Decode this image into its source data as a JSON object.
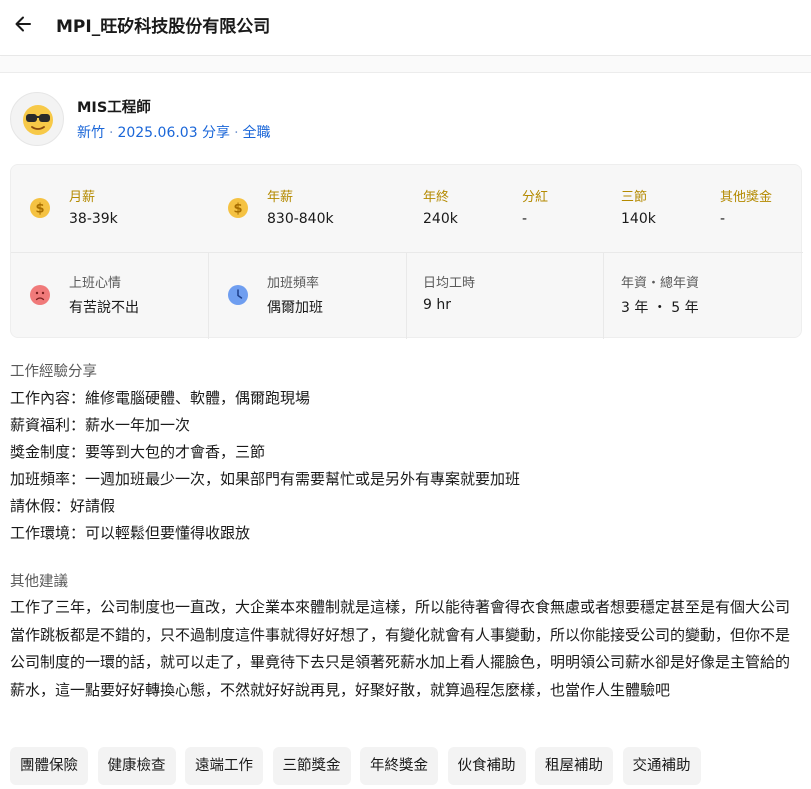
{
  "header": {
    "title": "MPI_旺矽科技股份有限公司"
  },
  "profile": {
    "job_title": "MIS工程師",
    "location": "新竹",
    "date_shared": "2025.06.03 分享",
    "employment_type": "全職",
    "avatar_icon": "sunglasses-face-icon"
  },
  "salary": {
    "monthly": {
      "label": "月薪",
      "value": "38-39k",
      "icon": "coin-icon"
    },
    "yearly": {
      "label": "年薪",
      "value": "830-840k",
      "icon": "coin-icon"
    },
    "year_end_bonus": {
      "label": "年終",
      "value": "240k"
    },
    "profit_sharing": {
      "label": "分紅",
      "value": "-"
    },
    "three_festivals": {
      "label": "三節",
      "value": "140k"
    },
    "other_bonus": {
      "label": "其他獎金",
      "value": "-"
    }
  },
  "work_stats": {
    "mood": {
      "label": "上班心情",
      "value": "有苦說不出",
      "icon": "sad-face-icon"
    },
    "overtime": {
      "label": "加班頻率",
      "value": "偶爾加班",
      "icon": "clock-icon"
    },
    "daily_hours": {
      "label": "日均工時",
      "value": "9 hr"
    },
    "seniority": {
      "label": "年資・總年資",
      "value": "3 年 ・ 5 年"
    }
  },
  "experience": {
    "heading": "工作經驗分享",
    "lines": [
      "工作內容：維修電腦硬體、軟體，偶爾跑現場",
      "薪資福利：薪水一年加一次",
      "獎金制度：要等到大包的才會香，三節",
      "加班頻率：一週加班最少一次，如果部門有需要幫忙或是另外有專案就要加班",
      "請休假：好請假",
      "工作環境：可以輕鬆但要懂得收跟放"
    ]
  },
  "advice": {
    "heading": "其他建議",
    "text": "工作了三年，公司制度也一直改，大企業本來體制就是這樣，所以能待著會得衣食無慮或者想要穩定甚至是有個大公司當作跳板都是不錯的，只不過制度這件事就得好好想了，有變化就會有人事變動，所以你能接受公司的變動，但你不是公司制度的一環的話，就可以走了，畢竟待下去只是領著死薪水加上看人擺臉色，明明領公司薪水卻是好像是主管給的薪水，這一點要好好轉換心態，不然就好好說再見，好聚好散，就算過程怎麼樣，也當作人生體驗吧"
  },
  "tags": [
    "團體保險",
    "健康檢查",
    "遠端工作",
    "三節獎金",
    "年終獎金",
    "伙食補助",
    "租屋補助",
    "交通補助"
  ],
  "colors": {
    "accent_blue": "#1a66d8",
    "gold_label": "#b48a00",
    "coin": "#f5c242",
    "sad_face": "#f07a7a",
    "clock": "#6f9ef0"
  }
}
